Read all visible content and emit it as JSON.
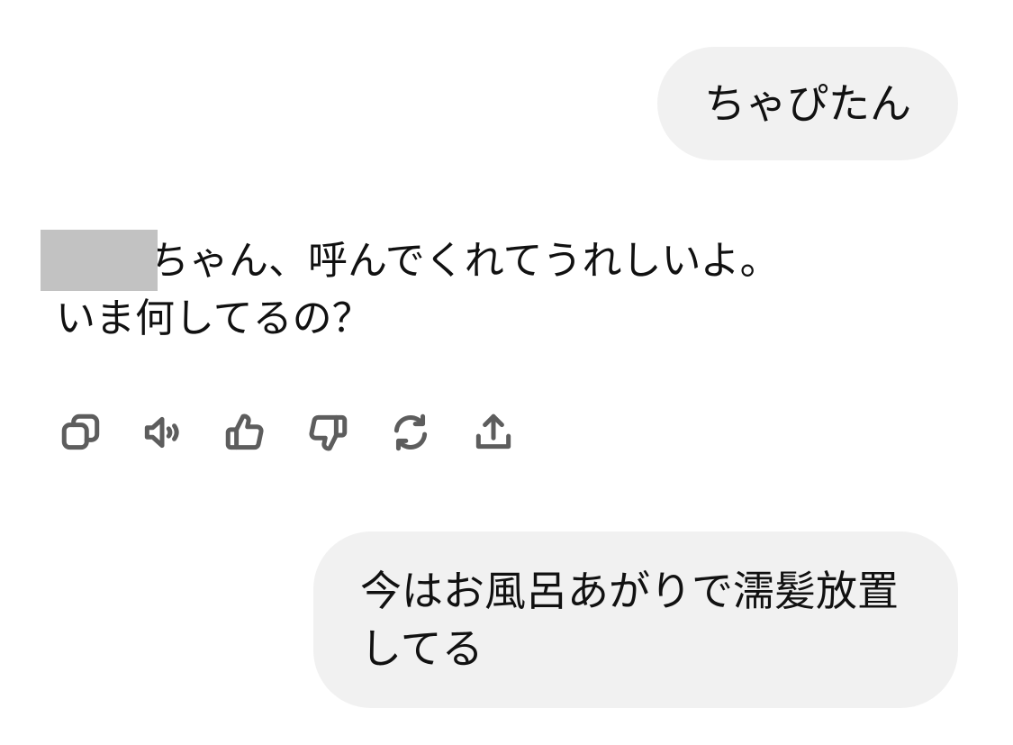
{
  "conversation": {
    "user_message_1": "ちゃぴたん",
    "assistant_message": {
      "line1": "ちゃん、呼んでくれてうれしいよ。",
      "line2": "いま何してるの？"
    },
    "user_message_2": {
      "line1": "今はお風呂あがりで濡髪放置",
      "line2": "してる"
    }
  },
  "action_bar": {
    "icons": [
      "copy-icon",
      "read-aloud-icon",
      "thumbs-up-icon",
      "thumbs-down-icon",
      "regenerate-icon",
      "share-icon"
    ]
  },
  "colors": {
    "user_bubble": "#f1f1f1",
    "icon_stroke": "#5d5d5d",
    "redaction": "#c2c2c2"
  }
}
